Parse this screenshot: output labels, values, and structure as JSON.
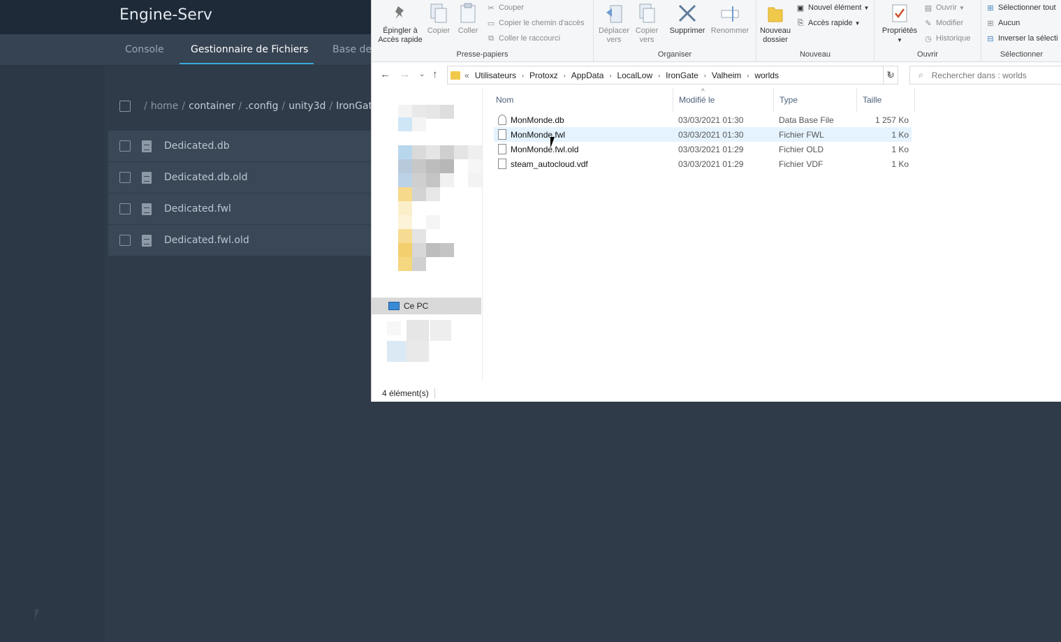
{
  "web": {
    "title": "Engine-Serv",
    "tabs": [
      "Console",
      "Gestionnaire de Fichiers",
      "Base de"
    ],
    "breadcrumb": [
      "/",
      "home",
      "/",
      "container",
      "/",
      ".config",
      "/",
      "unity3d",
      "/",
      "IronGate"
    ],
    "files": [
      "Dedicated.db",
      "Dedicated.db.old",
      "Dedicated.fwl",
      "Dedicated.fwl.old"
    ]
  },
  "explorer": {
    "ribbon": {
      "clipboard": {
        "pin": "Épingler à\nAccès rapide",
        "copy": "Copier",
        "paste": "Coller",
        "cut": "Couper",
        "copy_path": "Copier le chemin d'accès",
        "paste_shortcut": "Coller le raccourci",
        "label": "Presse-papiers"
      },
      "organize": {
        "move": "Déplacer\nvers",
        "copy_to": "Copier\nvers",
        "delete": "Supprimer",
        "rename": "Renommer",
        "label": "Organiser"
      },
      "new": {
        "new_folder": "Nouveau\ndossier",
        "new_item": "Nouvel élément",
        "quick_access": "Accès rapide",
        "label": "Nouveau"
      },
      "open": {
        "properties": "Propriétés",
        "open": "Ouvrir",
        "edit": "Modifier",
        "history": "Historique",
        "label": "Ouvrir"
      },
      "select": {
        "select_all": "Sélectionner tout",
        "none": "Aucun",
        "invert": "Inverser la sélecti",
        "label": "Sélectionner"
      }
    },
    "address": {
      "more": "«",
      "path": [
        "Utilisateurs",
        "Protoxz",
        "AppData",
        "LocalLow",
        "IronGate",
        "Valheim",
        "worlds"
      ]
    },
    "search_placeholder": "Rechercher dans : worlds",
    "nav": {
      "this_pc": "Ce PC"
    },
    "columns": {
      "name": "Nom",
      "modified": "Modifié le",
      "type": "Type",
      "size": "Taille"
    },
    "files": [
      {
        "name": "MonMonde.db",
        "date": "03/03/2021 01:30",
        "type": "Data Base File",
        "size": "1 257 Ko"
      },
      {
        "name": "MonMonde.fwl",
        "date": "03/03/2021 01:30",
        "type": "Fichier FWL",
        "size": "1 Ko"
      },
      {
        "name": "MonMonde.fwl.old",
        "date": "03/03/2021 01:29",
        "type": "Fichier OLD",
        "size": "1 Ko"
      },
      {
        "name": "steam_autocloud.vdf",
        "date": "03/03/2021 01:29",
        "type": "Fichier VDF",
        "size": "1 Ko"
      }
    ],
    "status": "4 élément(s)",
    "colors": {
      "hover_row": "#e5f3ff",
      "folder": "#f1c94a",
      "accent": "#3aa7d8"
    }
  }
}
